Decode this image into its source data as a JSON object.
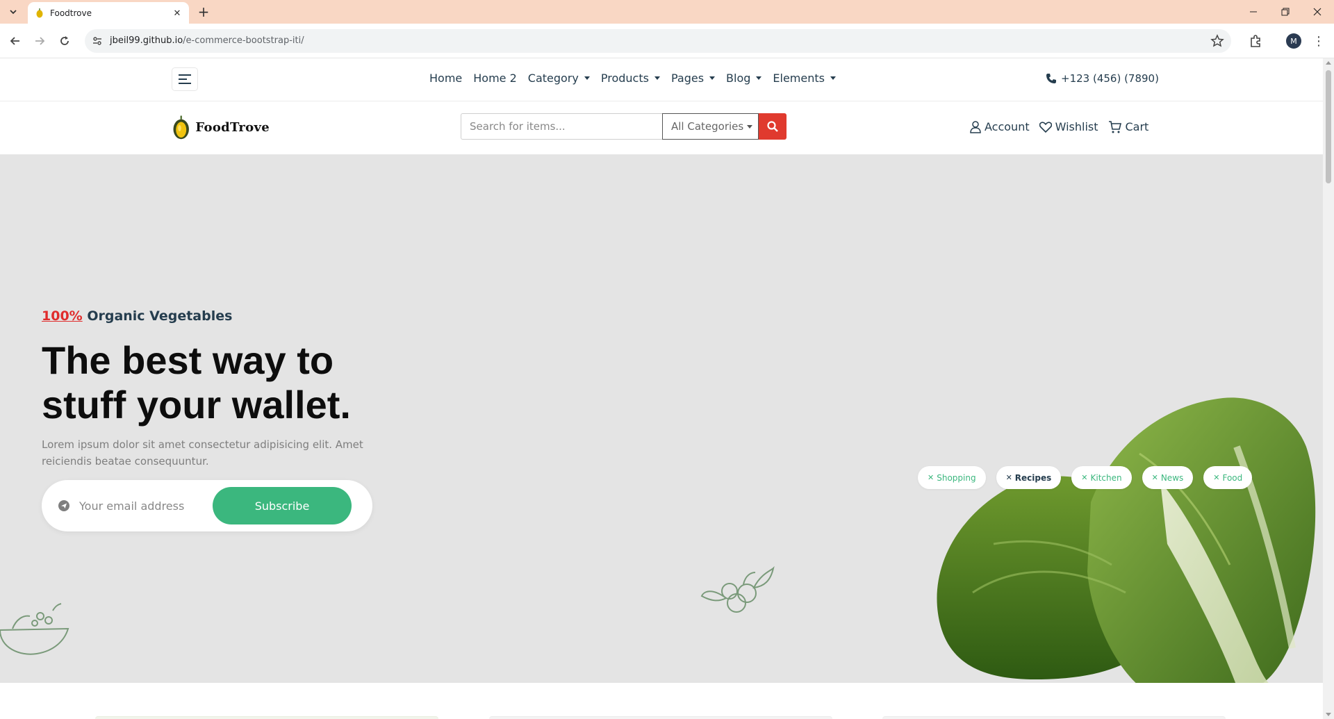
{
  "browser": {
    "tab_title": "Foodtrove",
    "url_host": "jbeil99.github.io",
    "url_path": "/e-commerce-bootstrap-iti/",
    "profile_initial": "M"
  },
  "topnav": {
    "links": [
      {
        "label": "Home",
        "dropdown": false
      },
      {
        "label": "Home 2",
        "dropdown": false
      },
      {
        "label": "Category",
        "dropdown": true
      },
      {
        "label": "Products",
        "dropdown": true
      },
      {
        "label": "Pages",
        "dropdown": true
      },
      {
        "label": "Blog",
        "dropdown": true
      },
      {
        "label": "Elements",
        "dropdown": true
      }
    ],
    "phone": "+123 (456) (7890)"
  },
  "header": {
    "logo_text": "FoodTrove",
    "search_placeholder": "Search for items...",
    "category_select": "All Categories",
    "account_label": "Account",
    "wishlist_label": "Wishlist",
    "cart_label": "Cart"
  },
  "hero": {
    "tagline_pct": "100%",
    "tagline_rest": " Organic Vegetables",
    "headline": "The best way to stuff your wallet.",
    "text": "Lorem ipsum dolor sit amet consectetur adipisicing elit. Amet reiciendis beatae consequuntur.",
    "email_placeholder": "Your email address",
    "subscribe_label": "Subscribe",
    "tags": [
      {
        "label": "Shopping",
        "active": false
      },
      {
        "label": "Recipes",
        "active": true
      },
      {
        "label": "Kitchen",
        "active": false
      },
      {
        "label": "News",
        "active": false
      },
      {
        "label": "Food",
        "active": false
      }
    ]
  },
  "colors": {
    "accent_green": "#3bb77e",
    "accent_red": "#e02d2d",
    "search_red": "#e03a2e",
    "heading": "#253d4e",
    "hero_bg": "#e4e4e4",
    "tab_bar": "#f9d7c4"
  }
}
